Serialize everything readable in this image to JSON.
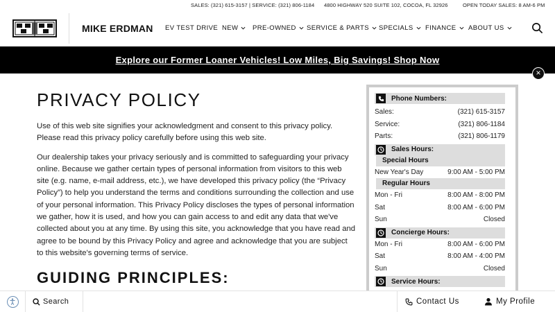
{
  "topbar": {
    "sales": "SALES: (321) 615-3157",
    "service": "| SERVICE: (321) 806-1184",
    "address": "4800 HIGHWAY 520 SUITE 102, COCOA, FL 32926",
    "hours": "OPEN TODAY SALES: 8 AM-6 PM"
  },
  "header": {
    "logo_icon": "cadillac-crest-icon",
    "brand": "MIKE ERDMAN",
    "nav": [
      {
        "label": "EV TEST DRIVE"
      },
      {
        "label": "NEW"
      },
      {
        "label": "PRE-OWNED"
      },
      {
        "label": "SERVICE & PARTS"
      },
      {
        "label": "SPECIALS"
      },
      {
        "label": "FINANCE"
      },
      {
        "label": "ABOUT US"
      }
    ],
    "search_icon": "search-icon"
  },
  "banner": {
    "text": "Explore our Former Loaner Vehicles! Low Miles, Big Savings! Shop Now",
    "close": "×",
    "bg": "#000000"
  },
  "main": {
    "title": "PRIVACY POLICY",
    "paragraph1": "Use of this web site signifies your acknowledgment and consent to this privacy policy. Please read this privacy policy carefully before using this web site.",
    "paragraph2": "Our dealership takes your privacy seriously and is committed to safeguarding your privacy online. Because we gather certain types of personal information from visitors to this web site (e.g. name, e-mail address, etc.), we have developed this privacy policy (the “Privacy Policy”) to help you understand the terms and conditions surrounding the collection and use of your personal information. This Privacy Policy discloses the types of personal information we gather, how it is used, and how you can gain access to and edit any data that we've collected about you at any time. By using this site, you acknowledge that you have read and agree to be bound by this Privacy Policy and agree and acknowledge that you are subject to this website's governing terms of service.",
    "section_title": "GUIDING PRINCIPLES:"
  },
  "sidebar": {
    "phone": {
      "title": "Phone Numbers:",
      "rows": [
        {
          "label": "Sales:",
          "value": "(321) 615-3157"
        },
        {
          "label": "Service:",
          "value": "(321) 806-1184"
        },
        {
          "label": "Parts:",
          "value": "(321) 806-1179"
        }
      ]
    },
    "sales_hours": {
      "title": "Sales Hours:",
      "special_title": "Special Hours",
      "special_rows": [
        {
          "label": "New Year's Day",
          "value": "9:00 AM - 5:00 PM"
        }
      ],
      "regular_title": "Regular Hours",
      "regular_rows": [
        {
          "label": "Mon - Fri",
          "value": "8:00 AM - 8:00 PM"
        },
        {
          "label": "Sat",
          "value": "8:00 AM - 6:00 PM"
        },
        {
          "label": "Sun",
          "value": "Closed"
        }
      ]
    },
    "concierge_hours": {
      "title": "Concierge Hours:",
      "rows": [
        {
          "label": "Mon - Fri",
          "value": "8:00 AM - 6:00 PM"
        },
        {
          "label": "Sat",
          "value": "8:00 AM - 4:00 PM"
        },
        {
          "label": "Sun",
          "value": "Closed"
        }
      ]
    },
    "service_hours": {
      "title": "Service Hours:"
    }
  },
  "bottombar": {
    "accessibility_icon": "accessibility-icon",
    "search_label": "Search",
    "contact_label": "Contact Us",
    "profile_label": "My Profile",
    "accent": "#6b8fb5"
  }
}
